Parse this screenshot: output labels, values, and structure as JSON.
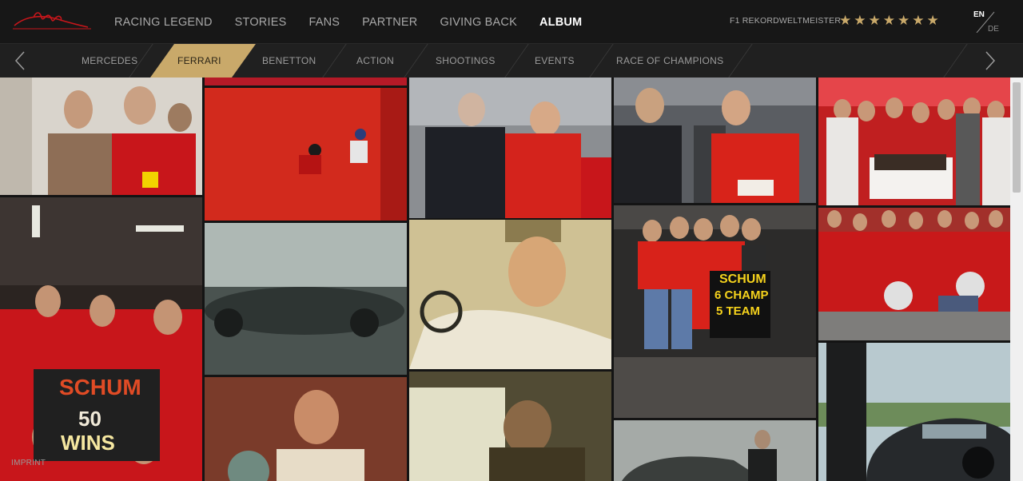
{
  "header": {
    "nav": [
      {
        "label": "RACING LEGEND",
        "active": false
      },
      {
        "label": "STORIES",
        "active": false
      },
      {
        "label": "FANS",
        "active": false
      },
      {
        "label": "PARTNER",
        "active": false
      },
      {
        "label": "GIVING BACK",
        "active": false
      },
      {
        "label": "ALBUM",
        "active": true
      }
    ],
    "title_text": "F1 REKORDWELTMEISTER",
    "stars_count": 7,
    "star_glyph": "★",
    "lang_active": "EN",
    "lang_other": "DE"
  },
  "categories": [
    {
      "label": "MERCEDES",
      "active": false
    },
    {
      "label": "FERRARI",
      "active": true
    },
    {
      "label": "BENETTON",
      "active": false
    },
    {
      "label": "ACTION",
      "active": false
    },
    {
      "label": "SHOOTINGS",
      "active": false
    },
    {
      "label": "EVENTS",
      "active": false
    },
    {
      "label": "RACE OF CHAMPIONS",
      "active": false
    }
  ],
  "icons": {
    "prev": "chevron-left-icon",
    "next": "chevron-right-icon",
    "logo": "signature-logo"
  },
  "photos": {
    "sign1_line1": "SCHUM",
    "sign1_line2": "50",
    "sign1_line3": "WINS",
    "sign2_line1": "SCHUM",
    "sign2_line2": "6 CHAMP",
    "sign2_line3": "5 TEAM"
  },
  "footer": {
    "imprint": "IMPRINT"
  },
  "colors": {
    "accent_gold": "#c9a96a",
    "ferrari_red": "#c8161b",
    "bg": "#1c1c1c"
  }
}
